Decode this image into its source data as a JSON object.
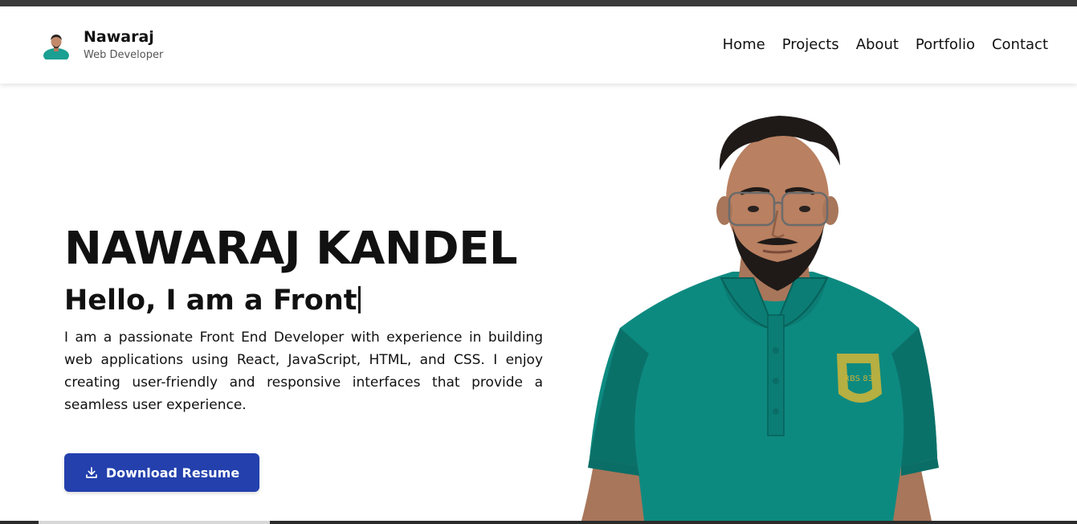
{
  "brand": {
    "name": "Nawaraj",
    "role": "Web Developer"
  },
  "nav": {
    "links": [
      "Home",
      "Projects",
      "About",
      "Portfolio",
      "Contact"
    ]
  },
  "hero": {
    "name": "NAWARAJ KANDEL",
    "greeting_prefix": "Hello, I am a ",
    "typed_role": "Front",
    "description": "I am a passionate Front End Developer with experience in building web applications using React, JavaScript, HTML, and CSS. I enjoy creating user-friendly and responsive interfaces that provide a seamless user experience.",
    "download_label": "Download Resume",
    "shirt_badge_text": "RBS 83"
  },
  "colors": {
    "accent": "#2340ad",
    "shirt": "#0d8a80",
    "text": "#111111"
  },
  "icons": {
    "download": "download-icon"
  }
}
